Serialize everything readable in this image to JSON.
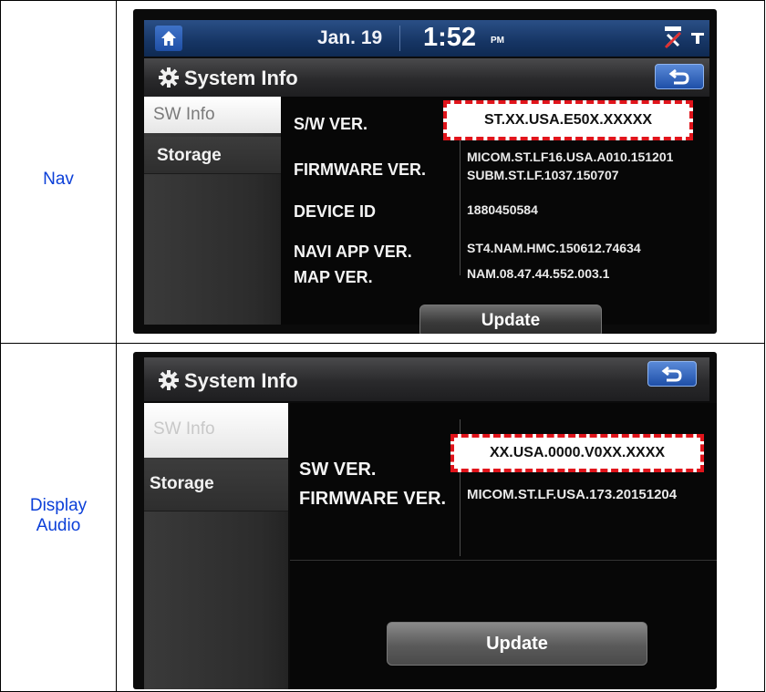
{
  "rows": [
    {
      "label": "Nav",
      "screen": {
        "status_bar": {
          "date": "Jan. 19",
          "time": "1:52",
          "ampm": "PM",
          "icons": [
            "home-icon",
            "navi-off-icon",
            "signal-icon"
          ]
        },
        "title": "System Info",
        "sidebar": [
          "SW Info",
          "Storage"
        ],
        "fields": [
          {
            "label": "S/W VER.",
            "value": "ST.XX.USA.E50X.XXXXX"
          },
          {
            "label": "FIRMWARE VER.",
            "value": "MICOM.ST.LF16.USA.A010.151201",
            "value2": "SUBM.ST.LF.1037.150707"
          },
          {
            "label": "DEVICE ID",
            "value": "1880450584"
          },
          {
            "label": "NAVI APP VER.",
            "value": "ST4.NAM.HMC.150612.74634"
          },
          {
            "label": "MAP VER.",
            "value": "NAM.08.47.44.552.003.1"
          }
        ],
        "button": "Update"
      }
    },
    {
      "label": "Display Audio",
      "screen": {
        "title": "System Info",
        "sidebar": [
          "SW Info",
          "Storage"
        ],
        "fields": [
          {
            "label": "SW VER.",
            "value": "XX.USA.0000.V0XX.XXXX"
          },
          {
            "label": "FIRMWARE VER.",
            "value": "MICOM.ST.LF.USA.173.20151204"
          }
        ],
        "button": "Update"
      }
    }
  ],
  "colors": {
    "highlight_border": "#e0141b",
    "row_label": "#0b3fd8",
    "topbar": "#163564"
  }
}
